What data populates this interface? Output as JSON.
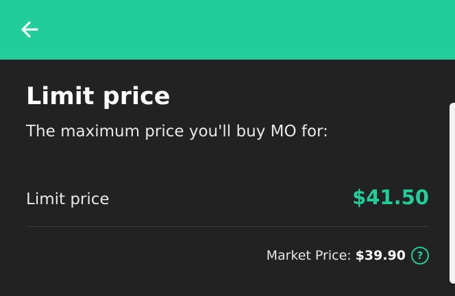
{
  "colors": {
    "accent": "#21ce99",
    "background": "#222223",
    "divider": "#3b3b3d",
    "text_primary": "#ffffff",
    "text_secondary": "#e8e8e8",
    "scrollbar": "#f2f2f2"
  },
  "header": {
    "back_icon": "arrow-left-icon"
  },
  "main": {
    "title": "Limit price",
    "subtitle": "The maximum price you'll buy MO for:",
    "limit_row": {
      "label": "Limit price",
      "value": "$41.50"
    },
    "market": {
      "label": "Market Price:",
      "value": "$39.90",
      "help_icon": "question-circle-icon",
      "help_glyph": "?"
    }
  }
}
